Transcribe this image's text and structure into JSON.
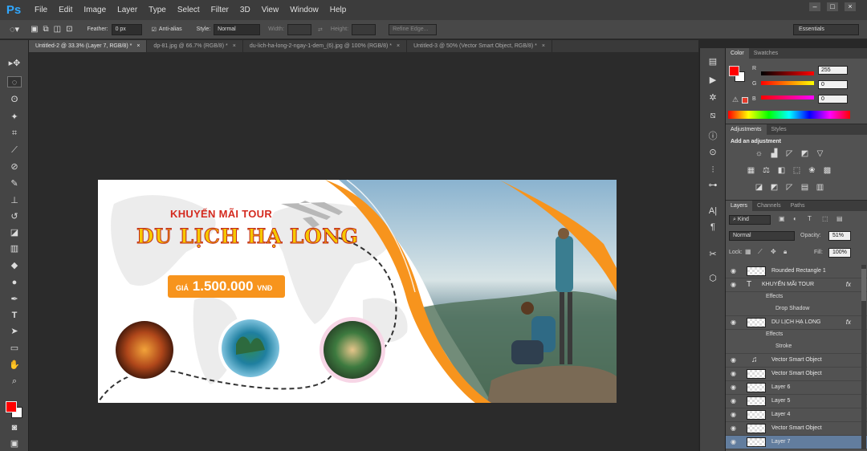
{
  "app": {
    "logo": "Ps"
  },
  "menu": [
    "File",
    "Edit",
    "Image",
    "Layer",
    "Type",
    "Select",
    "Filter",
    "3D",
    "View",
    "Window",
    "Help"
  ],
  "options": {
    "feather_label": "Feather:",
    "feather_value": "0 px",
    "antialias_label": "Anti-alias",
    "style_label": "Style:",
    "style_value": "Normal",
    "width_label": "Width:",
    "height_label": "Height:",
    "refine_label": "Refine Edge...",
    "workspace": "Essentials"
  },
  "tabs": [
    "Untitled-2 @ 33.3% (Layer 7, RGB/8) *",
    "dp-81.jpg @ 66.7% (RGB/8) *",
    "du-lich-ha-long-2-ngay-1-dem_(6).jpg @ 100% (RGB/8) *",
    "Untitled-3 @ 50% (Vector Smart Object, RGB/8) *"
  ],
  "banner": {
    "promo": "KHUYẾN MÃI TOUR",
    "title": "DU LỊCH HẠ LONG",
    "price_prefix": "GIÁ",
    "price": "1.500.000",
    "currency": "VNĐ"
  },
  "color_panel": {
    "tabs": [
      "Color",
      "Swatches"
    ],
    "channels": [
      {
        "label": "R",
        "value": "255"
      },
      {
        "label": "G",
        "value": "0"
      },
      {
        "label": "B",
        "value": "0"
      }
    ],
    "foreground": "#ff0000",
    "background": "#ffffff"
  },
  "adjustments": {
    "tabs": [
      "Adjustments",
      "Styles"
    ],
    "heading": "Add an adjustment"
  },
  "layers_panel": {
    "tabs": [
      "Layers",
      "Channels",
      "Paths"
    ],
    "filter": "Kind",
    "blend_mode": "Normal",
    "opacity_label": "Opacity:",
    "opacity": "51%",
    "lock_label": "Lock:",
    "fill_label": "Fill:",
    "fill": "100%",
    "layers": [
      {
        "name": "Rounded Rectangle 1",
        "kind": "shape"
      },
      {
        "name": "KHUYẾN MÃI TOUR",
        "kind": "text",
        "fx": true
      },
      {
        "name": "Effects",
        "kind": "sub1"
      },
      {
        "name": "Drop Shadow",
        "kind": "sub2"
      },
      {
        "name": "DU LỊCH HẠ LONG",
        "kind": "shape",
        "fx": true
      },
      {
        "name": "Effects",
        "kind": "sub1"
      },
      {
        "name": "Stroke",
        "kind": "sub2"
      },
      {
        "name": "Vector Smart Object",
        "kind": "smart"
      },
      {
        "name": "Vector Smart Object",
        "kind": "shape"
      },
      {
        "name": "Layer 6",
        "kind": "shape"
      },
      {
        "name": "Layer 5",
        "kind": "shape"
      },
      {
        "name": "Layer 4",
        "kind": "shape"
      },
      {
        "name": "Vector Smart Object",
        "kind": "shape"
      },
      {
        "name": "Layer 7",
        "kind": "shape",
        "selected": true
      }
    ]
  },
  "colors": {
    "accent": "#f7941d",
    "title_red": "#d42a1f",
    "title_yellow": "#f6c800",
    "selection": "#627d9e"
  }
}
